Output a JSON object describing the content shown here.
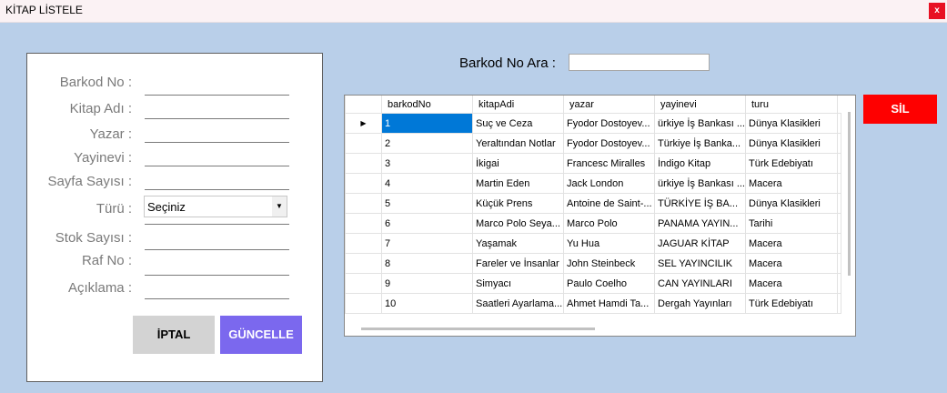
{
  "window": {
    "title": "KİTAP LİSTELE",
    "close_label": "x"
  },
  "form": {
    "labels": {
      "barkod": "Barkod No :",
      "kitap_adi": "Kitap Adı :",
      "yazar": "Yazar :",
      "yayinevi": "Yayinevi :",
      "sayfa": "Sayfa Sayısı :",
      "turu": "Türü :",
      "stok": "Stok Sayısı :",
      "raf": "Raf No :",
      "aciklama": "Açıklama :"
    },
    "turu_selected": "Seçiniz",
    "iptal_label": "İPTAL",
    "guncelle_label": "GÜNCELLE"
  },
  "search": {
    "label": "Barkod No Ara :",
    "value": ""
  },
  "sil_label": "SİL",
  "grid": {
    "columns": [
      "barkodNo",
      "kitapAdi",
      "yazar",
      "yayinevi",
      "turu"
    ],
    "rows": [
      [
        "1",
        "Suç ve Ceza",
        "Fyodor Dostoyev...",
        "ürkiye İş Bankası ...",
        "Dünya Klasikleri"
      ],
      [
        "2",
        "Yeraltından Notlar",
        "Fyodor Dostoyev...",
        "Türkiye İş Banka...",
        "Dünya Klasikleri"
      ],
      [
        "3",
        "İkigai",
        "Francesc Miralles",
        "İndigo Kitap",
        "Türk Edebiyatı"
      ],
      [
        "4",
        "Martin Eden",
        "Jack London",
        "ürkiye İş Bankası ...",
        "Macera"
      ],
      [
        "5",
        "Küçük Prens",
        "Antoine de Saint-...",
        "TÜRKİYE İŞ BA...",
        "Dünya Klasikleri"
      ],
      [
        "6",
        "Marco Polo Seya...",
        "Marco Polo",
        "PANAMA YAYIN...",
        "Tarihi"
      ],
      [
        "7",
        "Yaşamak",
        "Yu Hua",
        "JAGUAR KİTAP",
        "Macera"
      ],
      [
        "8",
        "Fareler ve İnsanlar",
        "John Steinbeck",
        "SEL YAYINCILIK",
        "Macera"
      ],
      [
        "9",
        "Simyacı",
        "Paulo Coelho",
        "CAN YAYINLARI",
        "Macera"
      ],
      [
        "10",
        "Saatleri Ayarlama...",
        "Ahmet Hamdi Ta...",
        "Dergah Yayınları",
        "Türk Edebiyatı"
      ]
    ]
  }
}
